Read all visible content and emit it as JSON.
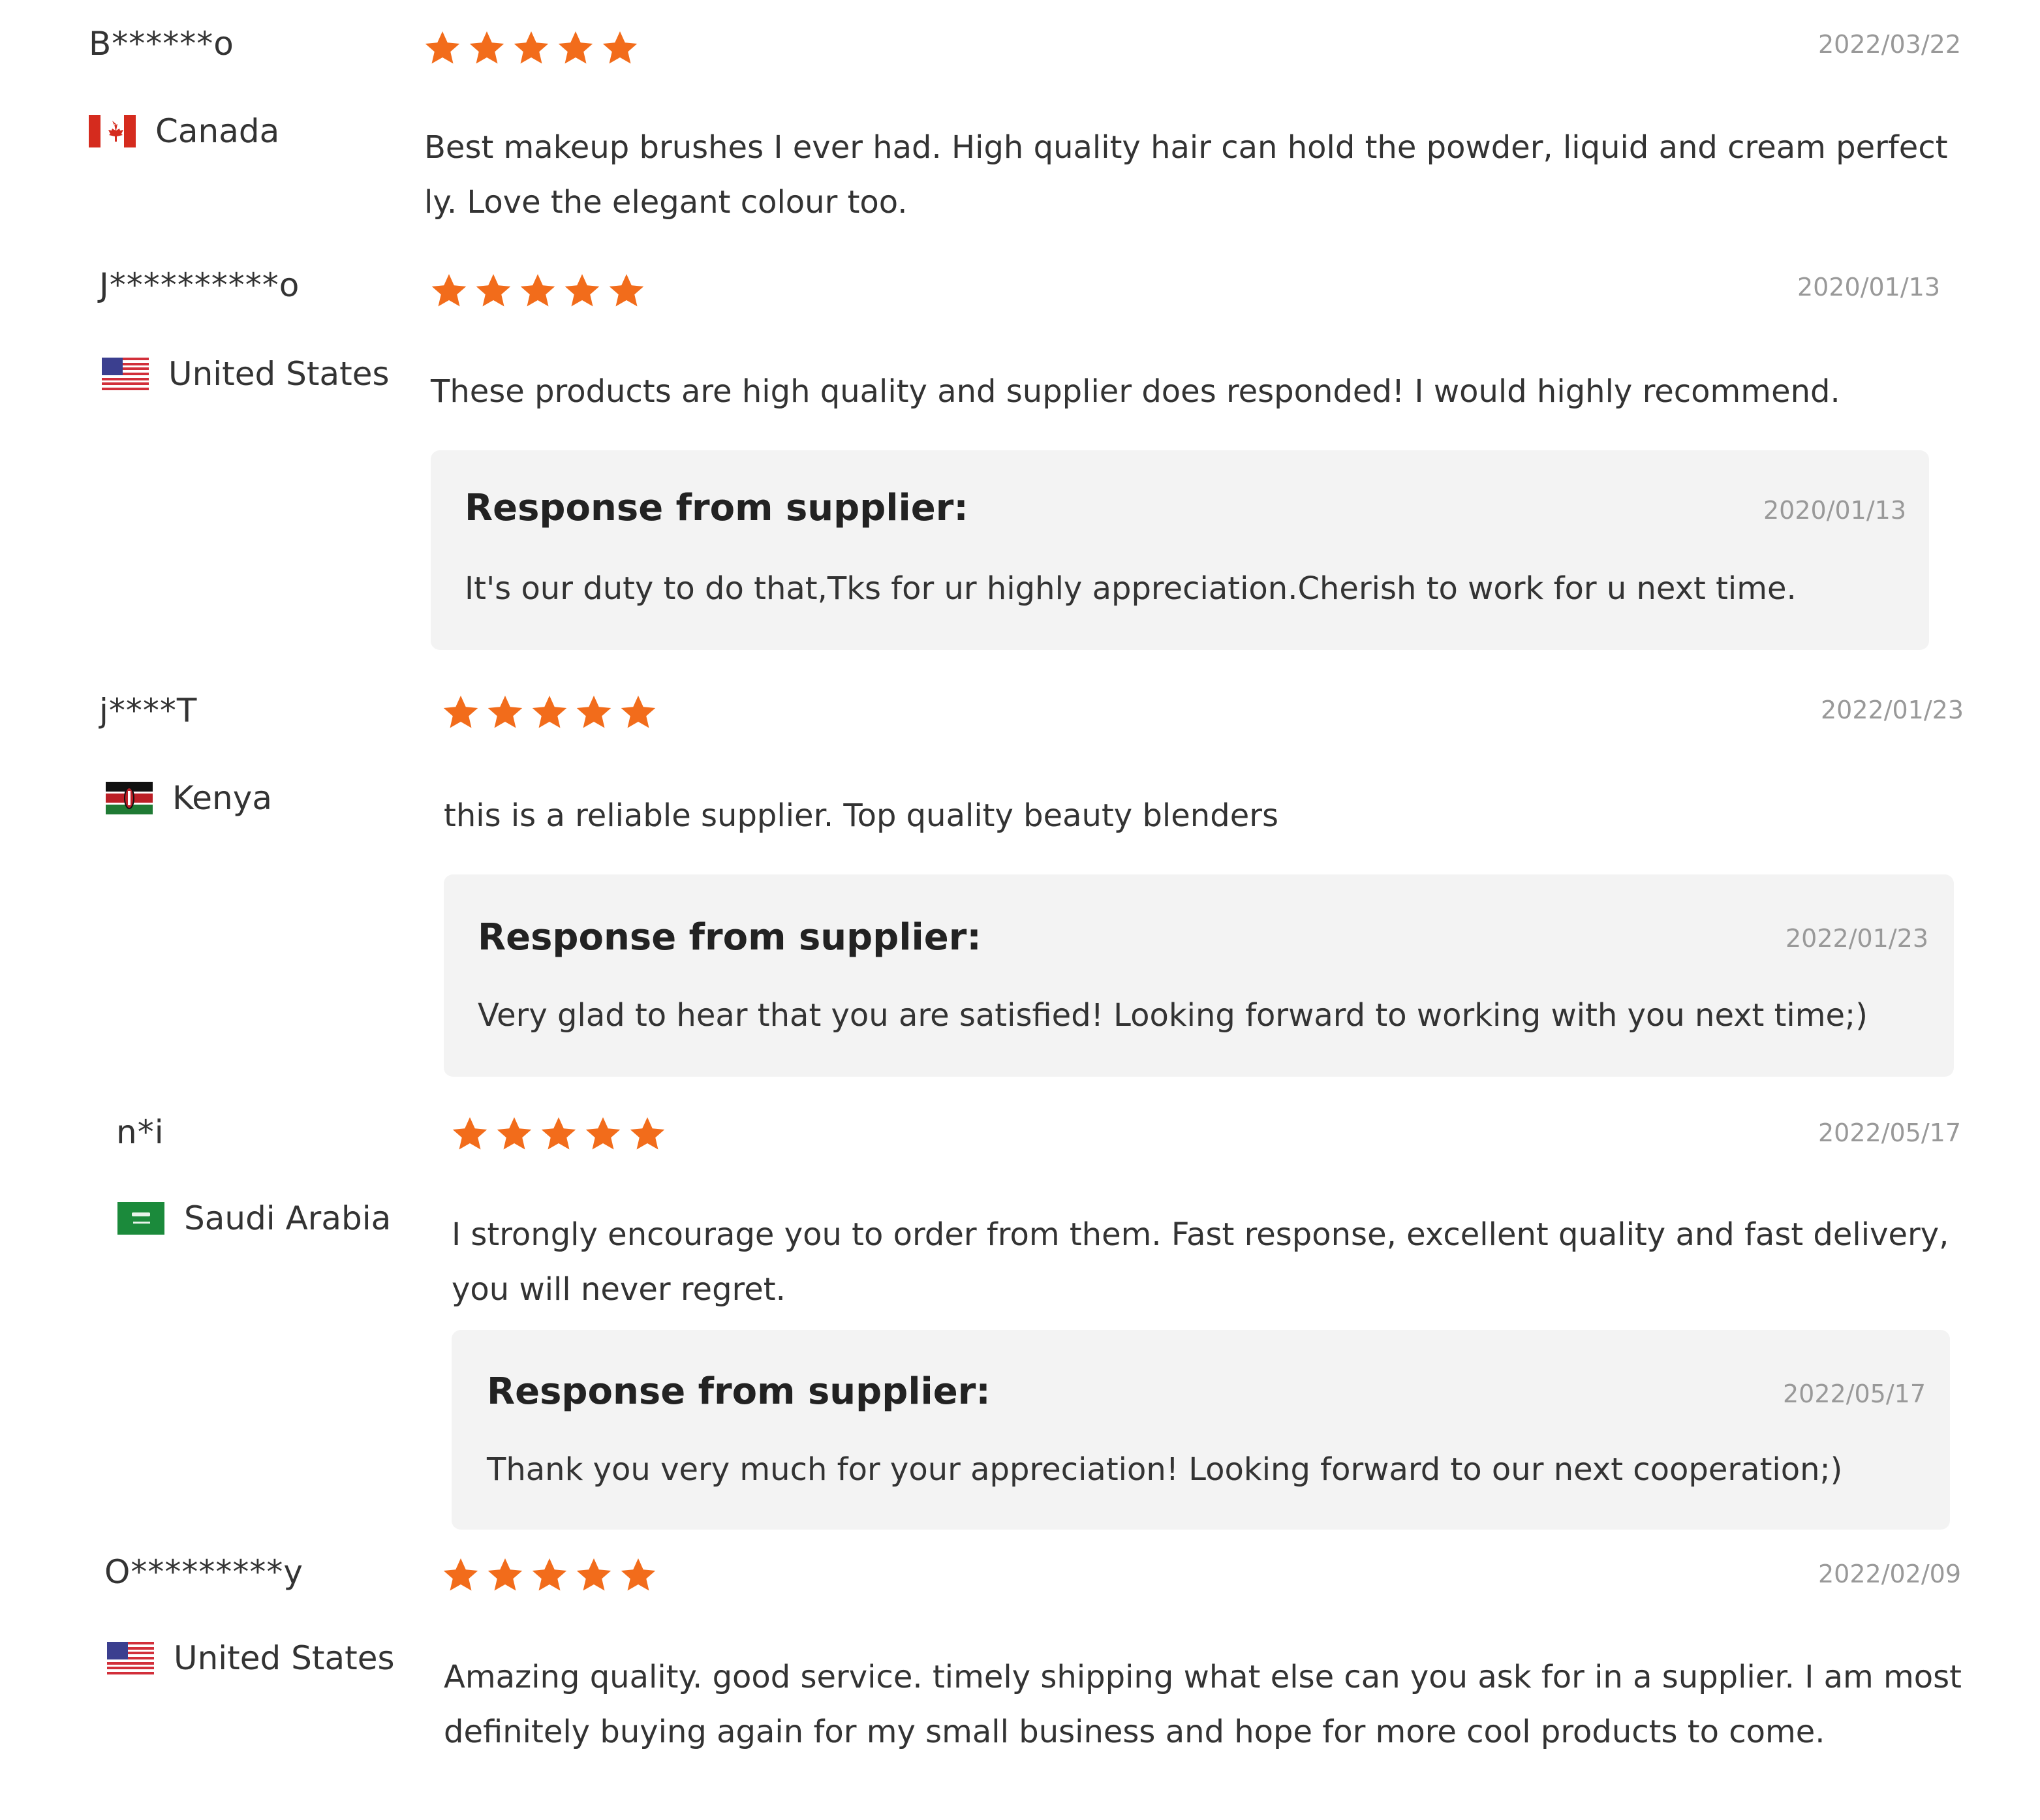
{
  "colors": {
    "star": "#f26c1b",
    "date": "#999999",
    "text": "#333333",
    "response_background": "#f3f3f3"
  },
  "reviews": [
    {
      "name": "B******o",
      "country": "Canada",
      "flag_icon": "canada-flag-icon",
      "rating": 5,
      "date": "2022/03/22",
      "text": "Best makeup brushes I ever had. High quality hair can hold the powder, liquid and cream perfectly. Love the elegant colour too."
    },
    {
      "name": "J**********o",
      "country": "United States",
      "flag_icon": "united-states-flag-icon",
      "rating": 5,
      "date": "2020/01/13",
      "text": "These products are high quality and supplier does responded! I would highly recommend.",
      "response": {
        "title": "Response from supplier:",
        "date": "2020/01/13",
        "text": "It's our duty to do that,Tks for ur highly appreciation.Cherish to work for u next time."
      }
    },
    {
      "name": "j****T",
      "country": "Kenya",
      "flag_icon": "kenya-flag-icon",
      "rating": 5,
      "date": "2022/01/23",
      "text": "this is a reliable supplier. Top quality beauty blenders",
      "response": {
        "title": "Response from supplier:",
        "date": "2022/01/23",
        "text": "Very glad to hear that you are satisfied! Looking forward to working with you next time;)"
      }
    },
    {
      "name": "n*i",
      "country": "Saudi Arabia",
      "flag_icon": "saudi-arabia-flag-icon",
      "rating": 5,
      "date": "2022/05/17",
      "text": "I strongly encourage you to order from them. Fast response, excellent quality and fast delivery, you will never regret.",
      "response": {
        "title": "Response from supplier:",
        "date": "2022/05/17",
        "text": "Thank you very much for your appreciation! Looking forward to our next cooperation;)"
      }
    },
    {
      "name": "O*********y",
      "country": "United States",
      "flag_icon": "united-states-flag-icon",
      "rating": 5,
      "date": "2022/02/09",
      "text": "Amazing quality. good service. timely shipping what else can you ask for in a supplier. I am most definitely buying again for my small business and hope for more cool products to come."
    }
  ]
}
